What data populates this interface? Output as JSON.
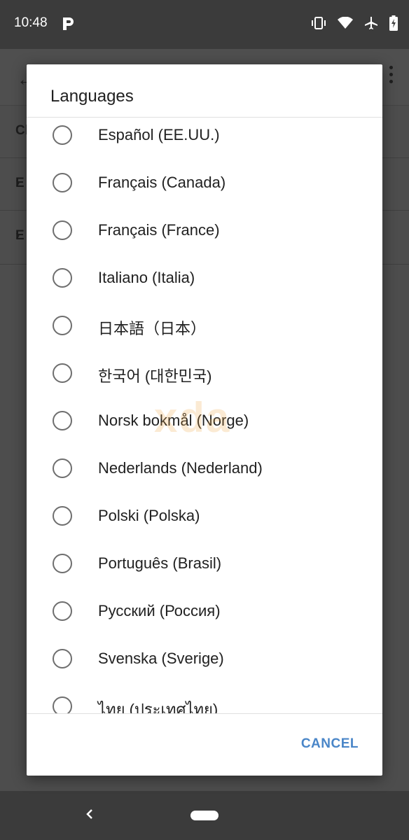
{
  "status_bar": {
    "time": "10:48",
    "icons": [
      "p-app-icon",
      "vibrate-icon",
      "wifi-icon",
      "airplane-icon",
      "battery-icon"
    ]
  },
  "background": {
    "rows": [
      "Ch",
      "E",
      "E"
    ]
  },
  "dialog": {
    "title": "Languages",
    "items": [
      {
        "label": "Español (EE.UU.)",
        "selected": false
      },
      {
        "label": "Français (Canada)",
        "selected": false
      },
      {
        "label": "Français (France)",
        "selected": false
      },
      {
        "label": "Italiano (Italia)",
        "selected": false
      },
      {
        "label": "日本語（日本）",
        "selected": false
      },
      {
        "label": "한국어 (대한민국)",
        "selected": false
      },
      {
        "label": "Norsk bokmål (Norge)",
        "selected": false
      },
      {
        "label": "Nederlands (Nederland)",
        "selected": false
      },
      {
        "label": "Polski (Polska)",
        "selected": false
      },
      {
        "label": "Português (Brasil)",
        "selected": false
      },
      {
        "label": "Русский (Россия)",
        "selected": false
      },
      {
        "label": "Svenska (Sverige)",
        "selected": false
      },
      {
        "label": "ไทย (ประเทศไทย)",
        "selected": false
      }
    ],
    "cancel_label": "CANCEL"
  },
  "watermark": "xda",
  "colors": {
    "accent": "#4a86c8",
    "radio_border": "#6e6e6e",
    "scrim": "#4a4a4a"
  }
}
